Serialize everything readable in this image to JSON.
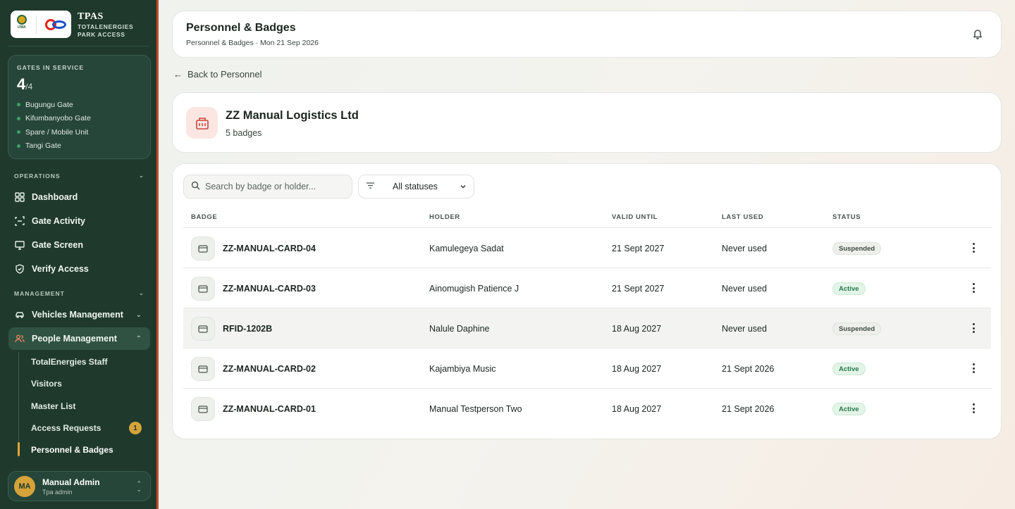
{
  "sidebar": {
    "brand_title": "TPAS",
    "brand_sub1": "TOTALENERGIES",
    "brand_sub2": "PARK ACCESS",
    "logo_text": "UWA",
    "gates": {
      "label": "GATES IN SERVICE",
      "count": "4",
      "total": "/4",
      "items": [
        "Bugungu Gate",
        "Kifumbanyobo Gate",
        "Spare / Mobile Unit",
        "Tangi Gate"
      ]
    },
    "operations_label": "OPERATIONS",
    "management_label": "MANAGEMENT",
    "nav": {
      "dashboard": "Dashboard",
      "gate_activity": "Gate Activity",
      "gate_screen": "Gate Screen",
      "verify_access": "Verify Access",
      "vehicles": "Vehicles Management",
      "people": "People Management"
    },
    "sub": {
      "staff": "TotalEnergies Staff",
      "visitors": "Visitors",
      "master": "Master List",
      "requests": "Access Requests",
      "requests_count": "1",
      "personnel": "Personnel & Badges"
    },
    "user": {
      "initials": "MA",
      "name": "Manual Admin",
      "role": "Tpa admin"
    }
  },
  "header": {
    "title": "Personnel & Badges",
    "crumb": "Personnel & Badges · Mon 21 Sep 2026"
  },
  "back_label": "Back to Personnel",
  "company": {
    "name": "ZZ Manual Logistics Ltd",
    "count": "5 badges"
  },
  "filters": {
    "search_placeholder": "Search by badge or holder...",
    "status_value": "All statuses"
  },
  "table": {
    "headers": [
      "BADGE",
      "HOLDER",
      "VALID UNTIL",
      "LAST USED",
      "STATUS"
    ],
    "rows": [
      {
        "badge": "ZZ-MANUAL-CARD-04",
        "holder": "Kamulegeya Sadat",
        "valid": "21 Sept 2027",
        "used": "Never used",
        "status": "Suspended"
      },
      {
        "badge": "ZZ-MANUAL-CARD-03",
        "holder": "Ainomugish Patience J",
        "valid": "21 Sept 2027",
        "used": "Never used",
        "status": "Active"
      },
      {
        "badge": "RFID-1202B",
        "holder": "Nalule Daphine",
        "valid": "18 Aug 2027",
        "used": "Never used",
        "status": "Suspended"
      },
      {
        "badge": "ZZ-MANUAL-CARD-02",
        "holder": "Kajambiya Music",
        "valid": "18 Aug 2027",
        "used": "21 Sept 2026",
        "status": "Active"
      },
      {
        "badge": "ZZ-MANUAL-CARD-01",
        "holder": "Manual Testperson Two",
        "valid": "18 Aug 2027",
        "used": "21 Sept 2026",
        "status": "Active"
      }
    ]
  },
  "colors": {
    "sidebar_bg": "#1f3a2c",
    "accent": "#d6a33a",
    "active_status": "#27794a"
  }
}
